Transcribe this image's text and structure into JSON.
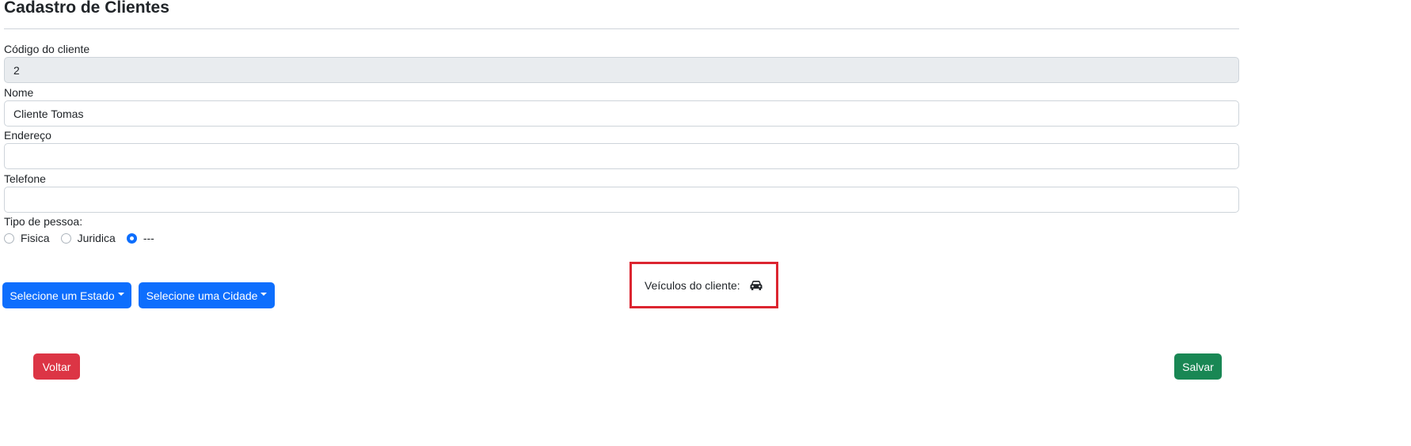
{
  "page": {
    "title": "Cadastro de Clientes"
  },
  "form": {
    "codigo": {
      "label": "Código do cliente",
      "value": "2"
    },
    "nome": {
      "label": "Nome",
      "value": "Cliente Tomas"
    },
    "endereco": {
      "label": "Endereço",
      "value": ""
    },
    "telefone": {
      "label": "Telefone",
      "value": ""
    },
    "tipo_pessoa": {
      "label": "Tipo de pessoa:",
      "options": [
        "Fisica",
        "Juridica",
        "---"
      ],
      "selected": "---"
    }
  },
  "dropdowns": {
    "estado_label": "Selecione um Estado",
    "cidade_label": "Selecione uma Cidade"
  },
  "veiculos": {
    "label": "Veículos do cliente:",
    "icon": "car-icon"
  },
  "actions": {
    "voltar_label": "Voltar",
    "salvar_label": "Salvar"
  },
  "colors": {
    "primary": "#0d6efd",
    "danger": "#dc3545",
    "success": "#198754",
    "highlight_border": "#dc2530"
  }
}
